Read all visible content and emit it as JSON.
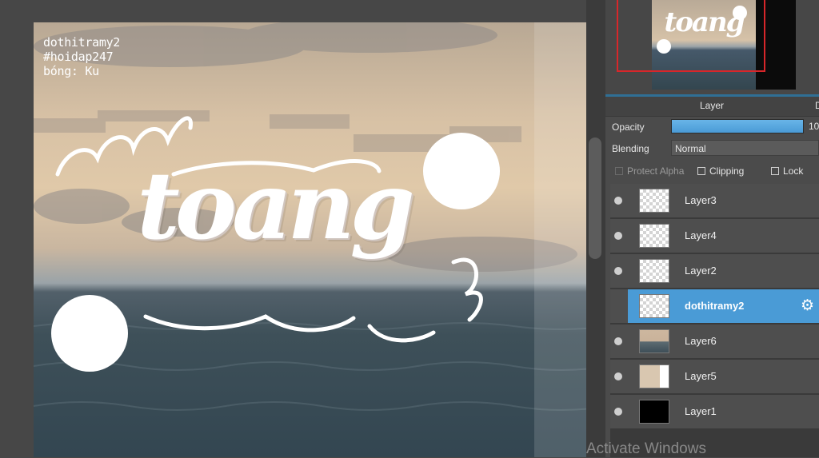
{
  "canvas": {
    "watermark": [
      "dothitramy2",
      "#hoidap247",
      "bóng: Ku"
    ],
    "artwork_title": "toang"
  },
  "navigator": {
    "preview_title": "toang",
    "frame_color": "#d8262a"
  },
  "layer_panel": {
    "tab_label": "Layer",
    "next_tab_label": "D",
    "opacity_label": "Opacity",
    "opacity_value": "10",
    "opacity_fraction": 1.0,
    "blending_label": "Blending",
    "blending_value": "Normal",
    "protect_alpha_label": "Protect Alpha",
    "clipping_label": "Clipping",
    "lock_label": "Lock",
    "layers": [
      {
        "name": "Layer3",
        "thumb": "checker",
        "selected": false
      },
      {
        "name": "Layer4",
        "thumb": "checker",
        "selected": false
      },
      {
        "name": "Layer2",
        "thumb": "checker",
        "selected": false
      },
      {
        "name": "dothitramy2",
        "thumb": "checker",
        "selected": true
      },
      {
        "name": "Layer6",
        "thumb": "photo",
        "selected": false
      },
      {
        "name": "Layer5",
        "thumb": "photo-wide",
        "selected": false
      },
      {
        "name": "Layer1",
        "thumb": "black",
        "selected": false
      }
    ]
  },
  "colors": {
    "accent": "#4a9bd6",
    "panel_bg": "#4b4b4b"
  },
  "os_overlay": "Activate Windows"
}
